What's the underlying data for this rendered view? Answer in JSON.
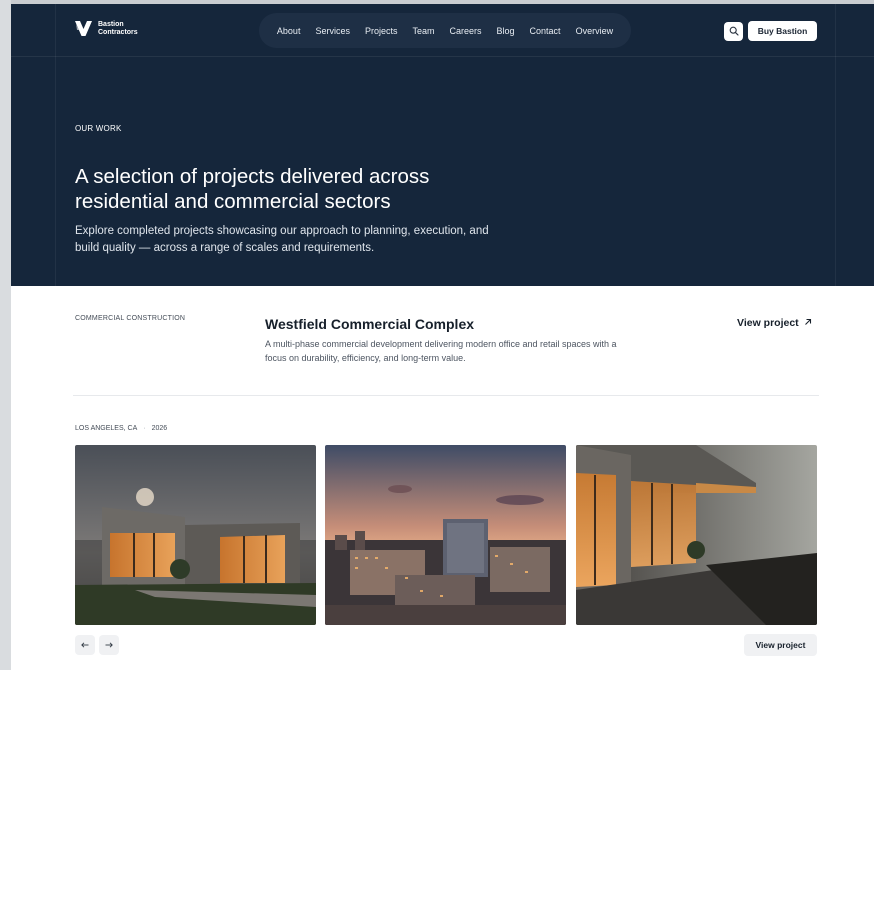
{
  "header": {
    "brand": {
      "line1": "Bastion",
      "line2": "Contractors",
      "logo_icon": "wing-logo-icon"
    },
    "nav": [
      {
        "label": "About"
      },
      {
        "label": "Services"
      },
      {
        "label": "Projects"
      },
      {
        "label": "Team"
      },
      {
        "label": "Careers"
      },
      {
        "label": "Blog"
      },
      {
        "label": "Contact"
      },
      {
        "label": "Overview"
      }
    ],
    "search_icon": "search-icon",
    "cta_label": "Buy Bastion"
  },
  "hero": {
    "eyebrow": "OUR WORK",
    "title": "A selection of projects delivered across residential and commercial sectors",
    "subtitle": "Explore completed projects showcasing our approach to planning, execution, and build quality — across a range of scales and requirements."
  },
  "project": {
    "category": "COMMERCIAL CONSTRUCTION",
    "title": "Westfield Commercial Complex",
    "description": "A multi-phase commercial development delivering modern office and retail spaces with a focus on durability, efficiency, and long-term value.",
    "view_link": "View project",
    "view_link_icon": "arrow-up-right-icon",
    "location": "LOS ANGELES, CA",
    "separator": "·",
    "year": "2026",
    "images": [
      {
        "name": "modern-house-dusk-photo"
      },
      {
        "name": "city-development-aerial-photo"
      },
      {
        "name": "stone-pavilion-terrace-photo"
      }
    ],
    "prev_icon": "arrow-left-icon",
    "next_icon": "arrow-right-icon",
    "view_button": "View project"
  },
  "colors": {
    "hero_bg": "#15263b",
    "nav_pill": "#1e2f45",
    "text_dark": "#17202b"
  }
}
